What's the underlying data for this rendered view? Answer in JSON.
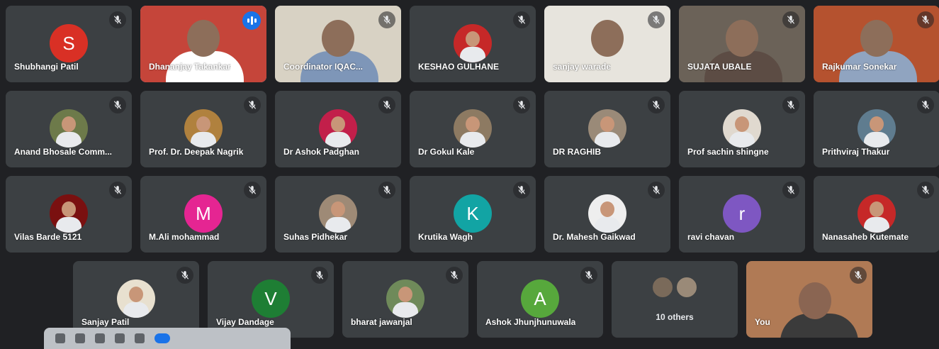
{
  "participants": [
    {
      "name": "Shubhangi Patil",
      "initial": "S",
      "color": "#d93025",
      "kind": "letter"
    },
    {
      "name": "Dhananjay Takankar",
      "kind": "video",
      "speaking": true,
      "bg": "#c5453a",
      "shirt": "#ffffff"
    },
    {
      "name": "Coordinator IQAC...",
      "kind": "video",
      "bg": "#d8d2c4",
      "shirt": "#7e96b8"
    },
    {
      "name": "KESHAO GULHANE",
      "kind": "photo",
      "bg": "#c62828"
    },
    {
      "name": "sanjay warade",
      "kind": "video",
      "bg": "#e7e4dd",
      "shirt": "#e7e4dd"
    },
    {
      "name": "SUJATA UBALE",
      "kind": "video",
      "bg": "#6b6258",
      "shirt": "#5c4c44"
    },
    {
      "name": "Rajkumar Sonekar",
      "kind": "video",
      "bg": "#b5522f",
      "shirt": "#90a4c0"
    },
    {
      "name": "Anand Bhosale Comm...",
      "kind": "photo",
      "bg": "#6d7a4a"
    },
    {
      "name": "Prof. Dr. Deepak Nagrik",
      "kind": "photo",
      "bg": "#b0813e"
    },
    {
      "name": "Dr Ashok Padghan",
      "kind": "photo",
      "bg": "#c21f4a"
    },
    {
      "name": "Dr Gokul Kale",
      "kind": "photo",
      "bg": "#8d7a62"
    },
    {
      "name": "DR RAGHIB",
      "kind": "photo",
      "bg": "#9a8a78"
    },
    {
      "name": "Prof sachin shingne",
      "kind": "photo",
      "bg": "#e0d9cf"
    },
    {
      "name": "Prithviraj Thakur",
      "kind": "photo",
      "bg": "#5f7c8f"
    },
    {
      "name": "Vilas Barde 5121",
      "kind": "photo",
      "bg": "#7a1010"
    },
    {
      "name": "M.Ali mohammad",
      "initial": "M",
      "color": "#e52592",
      "kind": "letter"
    },
    {
      "name": "Suhas Pidhekar",
      "kind": "photo",
      "bg": "#9e8a76"
    },
    {
      "name": "Krutika Wagh",
      "initial": "K",
      "color": "#12a4a4",
      "kind": "letter"
    },
    {
      "name": "Dr. Mahesh Gaikwad",
      "kind": "photo",
      "bg": "#eeeeee"
    },
    {
      "name": "ravi chavan",
      "initial": "r",
      "color": "#7e57c2",
      "kind": "letter"
    },
    {
      "name": "Nanasaheb Kutemate",
      "kind": "photo",
      "bg": "#c62828"
    },
    {
      "name": "Sanjay Patil",
      "kind": "photo",
      "bg": "#e8e0cf"
    },
    {
      "name": "Vijay Dandage",
      "initial": "V",
      "color": "#1e7e34",
      "kind": "letter"
    },
    {
      "name": "bharat jawanjal",
      "kind": "photo",
      "bg": "#6f8a5a"
    },
    {
      "name": "Ashok Jhunjhunuwala",
      "initial": "A",
      "color": "#57a83c",
      "kind": "letter"
    }
  ],
  "others": {
    "label": "10 others"
  },
  "self": {
    "label": "You"
  }
}
